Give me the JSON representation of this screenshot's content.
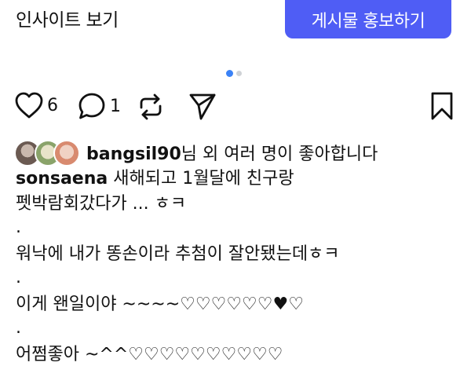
{
  "top": {
    "insight_label": "인사이트 보기",
    "promote_label": "게시물 홍보하기",
    "accent_color": "#4f5df5"
  },
  "carousel": {
    "total": 2,
    "active": 1
  },
  "actions": {
    "like_count": "6",
    "comment_count": "1",
    "icons": [
      "heart-icon",
      "comment-icon",
      "repost-icon",
      "send-icon",
      "bookmark-icon"
    ]
  },
  "liked_by": {
    "username": "bangsil90",
    "suffix": "님 외 여러 명이 좋아합니다"
  },
  "caption": {
    "username": "sonsaena",
    "first_text": " 새해되고 1월달에 친구랑",
    "lines": [
      "펫박람회갔다가 ... ㅎㅋ",
      ".",
      "워낙에 내가 똥손이라 추첨이 잘안됐는데ㅎㅋ",
      ".",
      "이게 왠일이야 ~~~~♡♡♡♡♡♡♥♡",
      ".",
      "어쩜좋아 ~^^♡♡♡♡♡♡♡♡♡♡"
    ]
  }
}
